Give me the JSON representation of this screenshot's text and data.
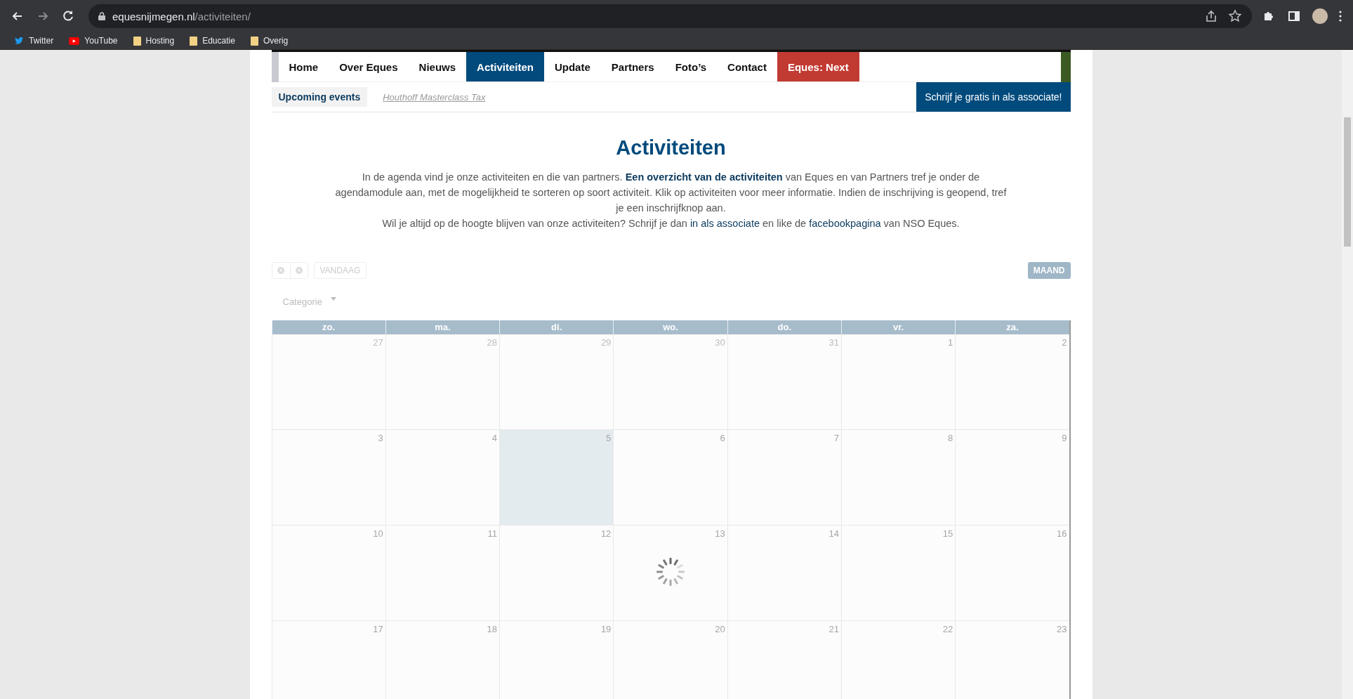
{
  "browser": {
    "url": {
      "host": "equesnijmegen.nl",
      "path": "/activiteiten/"
    },
    "bookmarks": [
      {
        "label": "Twitter",
        "kind": "twitter"
      },
      {
        "label": "YouTube",
        "kind": "youtube"
      },
      {
        "label": "Hosting",
        "kind": "folder"
      },
      {
        "label": "Educatie",
        "kind": "folder"
      },
      {
        "label": "Overig",
        "kind": "folder"
      }
    ]
  },
  "nav": {
    "items": [
      {
        "label": "Home",
        "selected": false,
        "kind": "normal"
      },
      {
        "label": "Over Eques",
        "selected": false,
        "kind": "normal"
      },
      {
        "label": "Nieuws",
        "selected": false,
        "kind": "normal"
      },
      {
        "label": "Activiteiten",
        "selected": true,
        "kind": "normal"
      },
      {
        "label": "Update",
        "selected": false,
        "kind": "normal"
      },
      {
        "label": "Partners",
        "selected": false,
        "kind": "normal"
      },
      {
        "label": "Foto’s",
        "selected": false,
        "kind": "normal"
      },
      {
        "label": "Contact",
        "selected": false,
        "kind": "normal"
      },
      {
        "label": "Eques: Next",
        "selected": false,
        "kind": "accent"
      }
    ]
  },
  "upcoming": {
    "label": "Upcoming events",
    "event": "Houthoff Masterclass Tax",
    "signup_button": "Schrijf je gratis in als associate!"
  },
  "title": "Activiteiten",
  "paragraphs": [
    [
      {
        "kind": "text",
        "text": "In de agenda vind je onze activiteiten en die van partners. "
      },
      {
        "kind": "bold-link",
        "text": "Een overzicht van de activiteiten"
      },
      {
        "kind": "text",
        "text": " van Eques en van Partners tref je onder de agendamodule aan, met de mogelijkheid te sorteren op soort activiteit. Klik op activiteiten voor meer informatie. Indien de inschrijving is geopend, tref je een inschrijfknop aan."
      }
    ],
    [
      {
        "kind": "text",
        "text": "Wil je altijd op de hoogte blijven van onze activiteiten? Schrijf je dan "
      },
      {
        "kind": "link",
        "text": "in als associate"
      },
      {
        "kind": "text",
        "text": " en like de "
      },
      {
        "kind": "link",
        "text": "facebookpagina"
      },
      {
        "kind": "text",
        "text": " van NSO Eques."
      }
    ]
  ],
  "calendar": {
    "today_button": "VANDAAG",
    "view_button": "MAAND",
    "category_filter": "Categorie",
    "weekdays": [
      "zo.",
      "ma.",
      "di.",
      "wo.",
      "do.",
      "vr.",
      "za."
    ],
    "weeks": [
      [
        {
          "day": "27",
          "other_month": true,
          "today": false
        },
        {
          "day": "28",
          "other_month": true,
          "today": false
        },
        {
          "day": "29",
          "other_month": true,
          "today": false
        },
        {
          "day": "30",
          "other_month": true,
          "today": false
        },
        {
          "day": "31",
          "other_month": true,
          "today": false
        },
        {
          "day": "1",
          "other_month": false,
          "today": false
        },
        {
          "day": "2",
          "other_month": false,
          "today": false
        }
      ],
      [
        {
          "day": "3",
          "other_month": false,
          "today": false
        },
        {
          "day": "4",
          "other_month": false,
          "today": false
        },
        {
          "day": "5",
          "other_month": false,
          "today": true
        },
        {
          "day": "6",
          "other_month": false,
          "today": false
        },
        {
          "day": "7",
          "other_month": false,
          "today": false
        },
        {
          "day": "8",
          "other_month": false,
          "today": false
        },
        {
          "day": "9",
          "other_month": false,
          "today": false
        }
      ],
      [
        {
          "day": "10",
          "other_month": false,
          "today": false
        },
        {
          "day": "11",
          "other_month": false,
          "today": false
        },
        {
          "day": "12",
          "other_month": false,
          "today": false
        },
        {
          "day": "13",
          "other_month": false,
          "today": false
        },
        {
          "day": "14",
          "other_month": false,
          "today": false
        },
        {
          "day": "15",
          "other_month": false,
          "today": false
        },
        {
          "day": "16",
          "other_month": false,
          "today": false
        }
      ],
      [
        {
          "day": "17",
          "other_month": false,
          "today": false
        },
        {
          "day": "18",
          "other_month": false,
          "today": false
        },
        {
          "day": "19",
          "other_month": false,
          "today": false
        },
        {
          "day": "20",
          "other_month": false,
          "today": false
        },
        {
          "day": "21",
          "other_month": false,
          "today": false
        },
        {
          "day": "22",
          "other_month": false,
          "today": false
        },
        {
          "day": "23",
          "other_month": false,
          "today": false
        }
      ]
    ]
  }
}
